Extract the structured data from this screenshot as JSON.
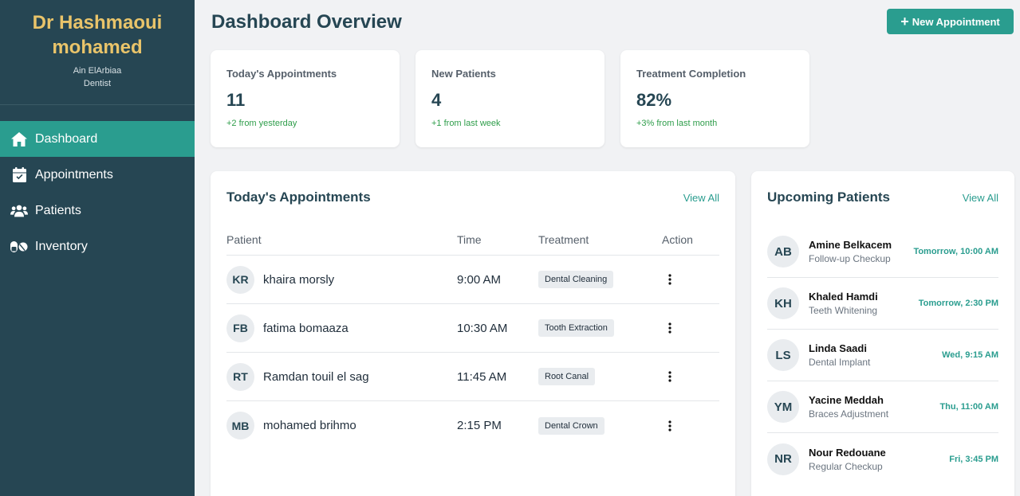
{
  "sidebar": {
    "doctor_name_line1": "Dr Hashmaoui",
    "doctor_name_line2": "mohamed",
    "location": "Ain ElArbiaa",
    "role": "Dentist",
    "items": [
      {
        "label": "Dashboard",
        "icon": "home-icon",
        "active": true
      },
      {
        "label": "Appointments",
        "icon": "calendar-check-icon",
        "active": false
      },
      {
        "label": "Patients",
        "icon": "users-icon",
        "active": false
      },
      {
        "label": "Inventory",
        "icon": "pills-icon",
        "active": false
      }
    ]
  },
  "header": {
    "title": "Dashboard Overview",
    "new_appointment_label": "New Appointment"
  },
  "stats": [
    {
      "title": "Today's Appointments",
      "value": "11",
      "change": "+2 from yesterday"
    },
    {
      "title": "New Patients",
      "value": "4",
      "change": "+1 from last week"
    },
    {
      "title": "Treatment Completion",
      "value": "82%",
      "change": "+3% from last month"
    }
  ],
  "appointments": {
    "title": "Today's Appointments",
    "view_all": "View All",
    "columns": [
      "Patient",
      "Time",
      "Treatment",
      "Action"
    ],
    "rows": [
      {
        "initials": "KR",
        "name": "khaira morsly",
        "time": "9:00 AM",
        "treatment": "Dental Cleaning"
      },
      {
        "initials": "FB",
        "name": "fatima bomaaza",
        "time": "10:30 AM",
        "treatment": "Tooth Extraction"
      },
      {
        "initials": "RT",
        "name": "Ramdan touil el sag",
        "time": "11:45 AM",
        "treatment": "Root Canal"
      },
      {
        "initials": "MB",
        "name": "mohamed brihmo",
        "time": "2:15 PM",
        "treatment": "Dental Crown"
      }
    ]
  },
  "upcoming": {
    "title": "Upcoming Patients",
    "view_all": "View All",
    "items": [
      {
        "initials": "AB",
        "name": "Amine Belkacem",
        "treatment": "Follow-up Checkup",
        "time": "Tomorrow, 10:00 AM"
      },
      {
        "initials": "KH",
        "name": "Khaled Hamdi",
        "treatment": "Teeth Whitening",
        "time": "Tomorrow, 2:30 PM"
      },
      {
        "initials": "LS",
        "name": "Linda Saadi",
        "treatment": "Dental Implant",
        "time": "Wed, 9:15 AM"
      },
      {
        "initials": "YM",
        "name": "Yacine Meddah",
        "treatment": "Braces Adjustment",
        "time": "Thu, 11:00 AM"
      },
      {
        "initials": "NR",
        "name": "Nour Redouane",
        "treatment": "Regular Checkup",
        "time": "Fri, 3:45 PM"
      }
    ]
  },
  "colors": {
    "sidebar_bg": "#264653",
    "accent": "#2a9d8f",
    "doctor_name": "#e9c46a",
    "positive_change": "#2e9d4a"
  }
}
